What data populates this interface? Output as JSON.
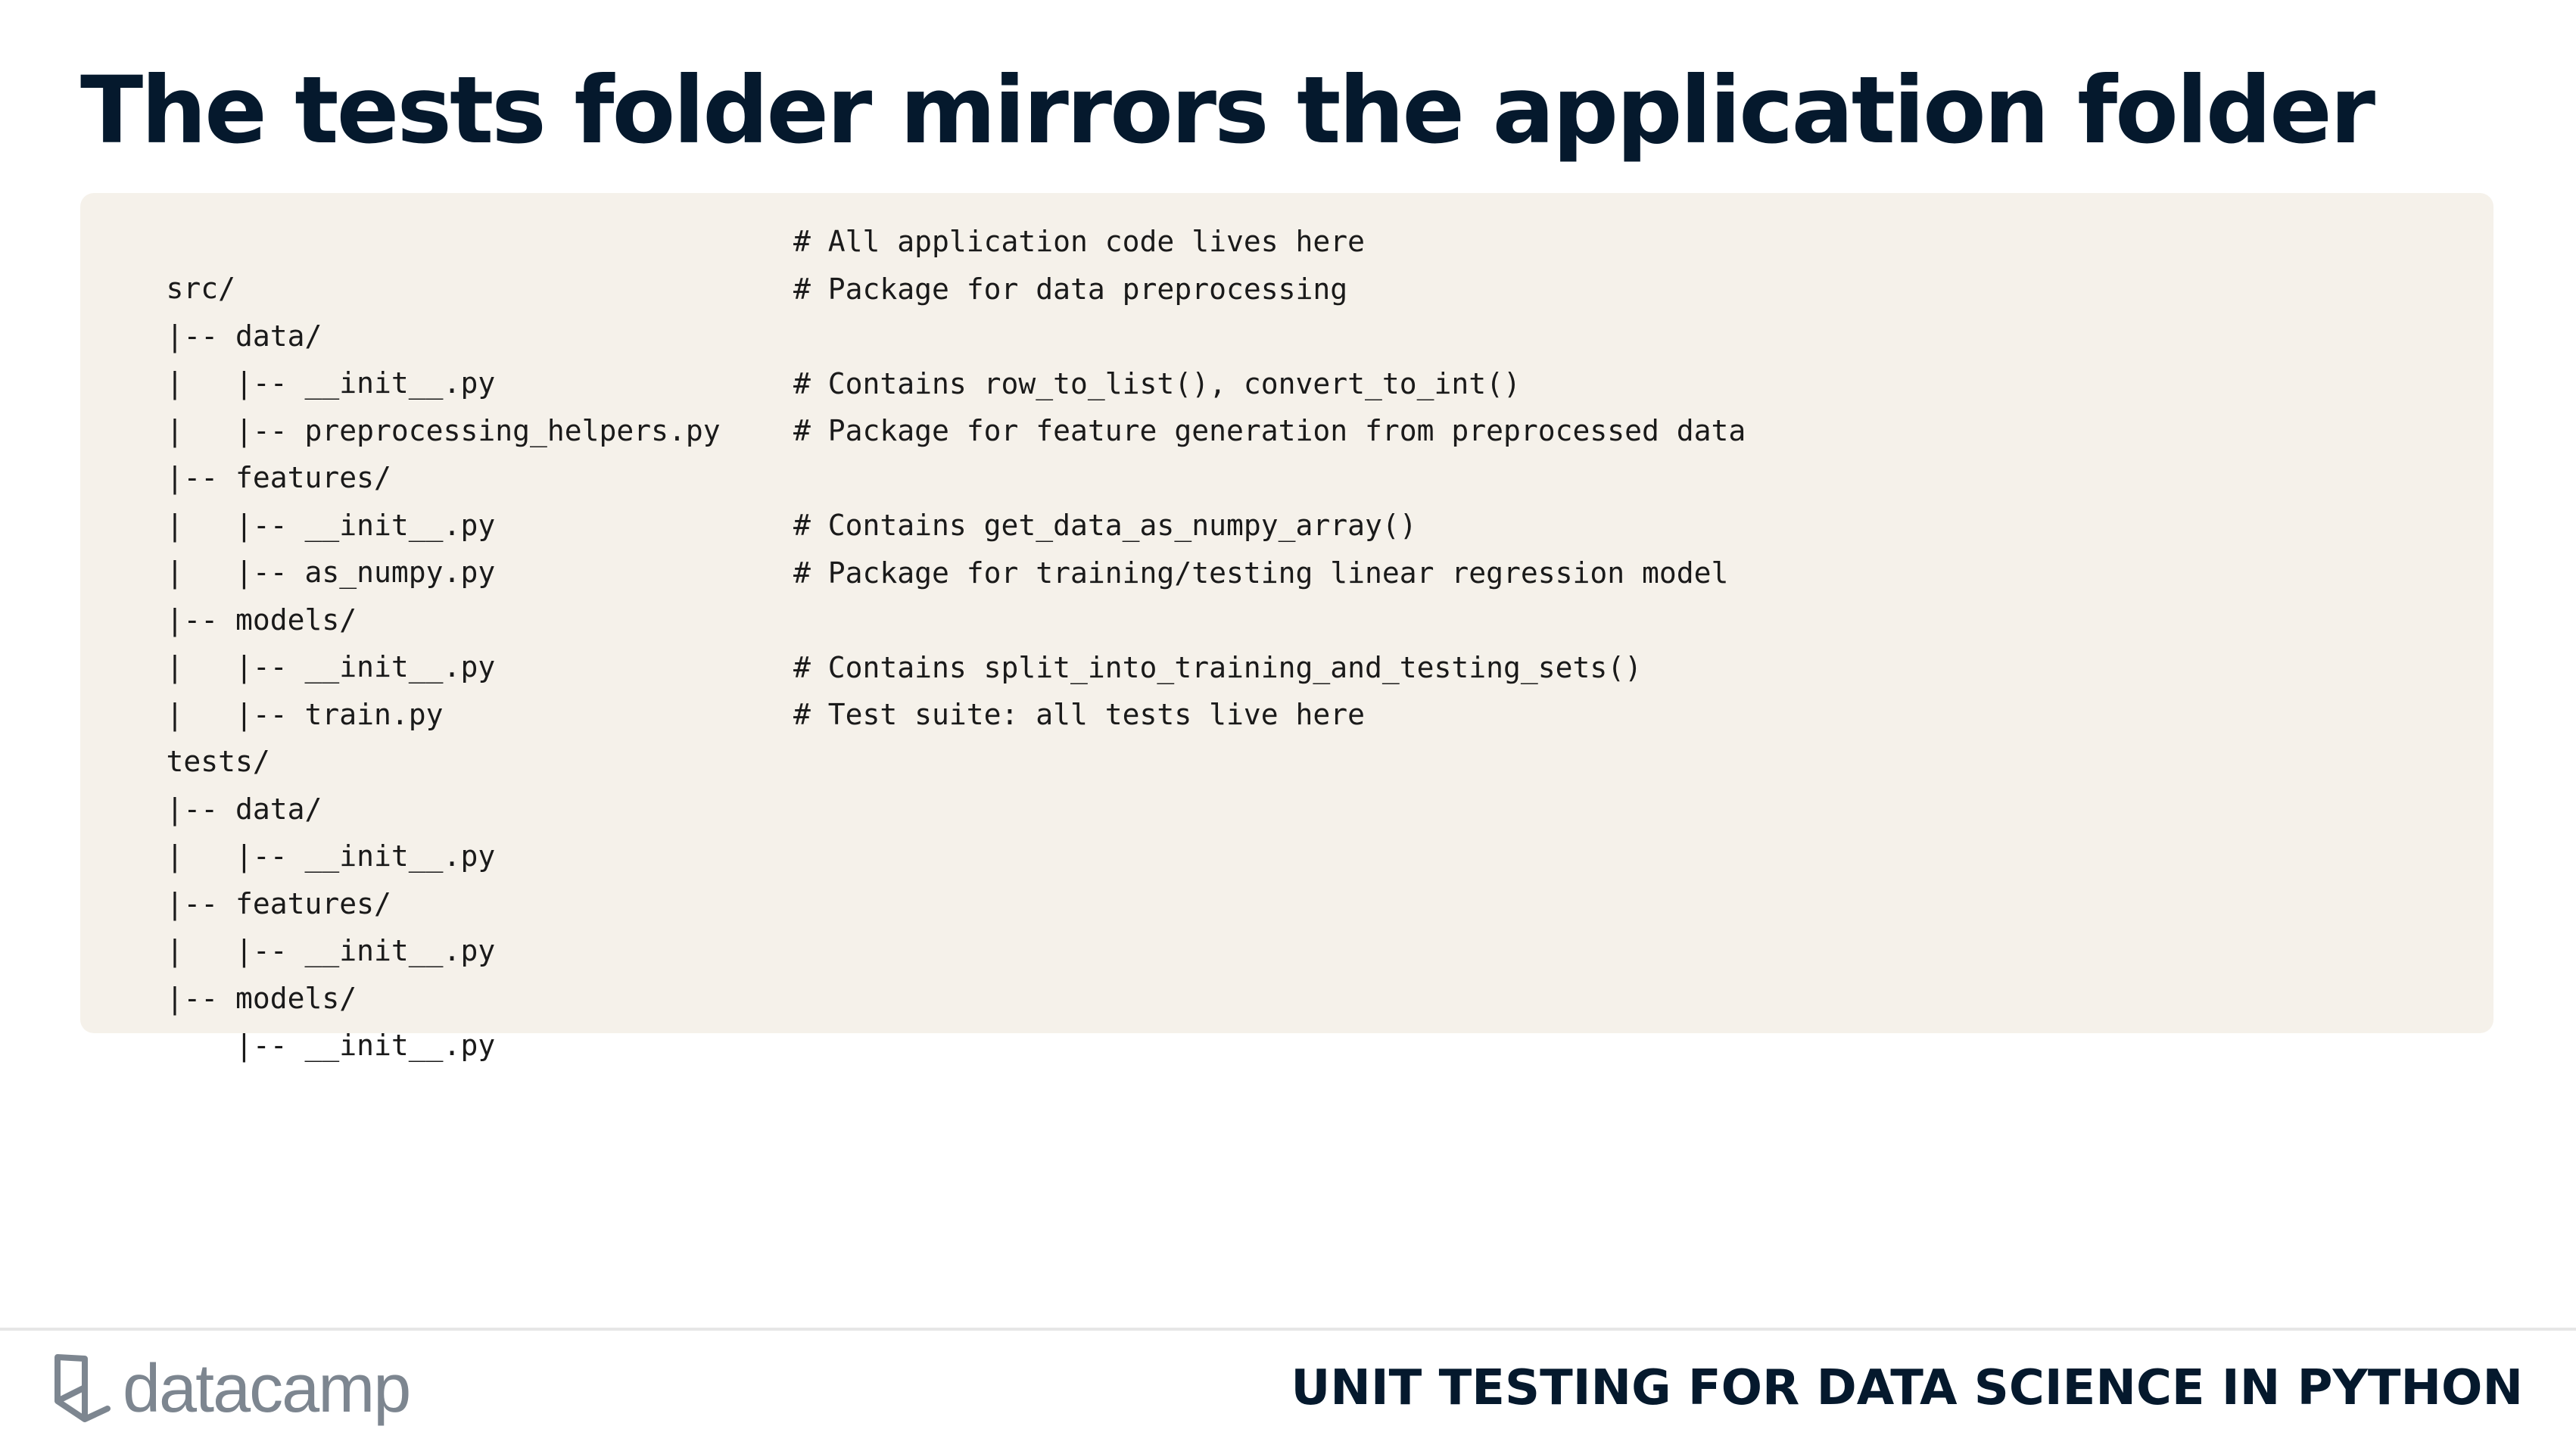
{
  "slide": {
    "title": "The tests folder mirrors the application folder"
  },
  "code": {
    "lines": [
      {
        "path": "src/",
        "comment": "# All application code lives here"
      },
      {
        "path": "|-- data/",
        "comment": "# Package for data preprocessing"
      },
      {
        "path": "|   |-- __init__.py",
        "comment": ""
      },
      {
        "path": "|   |-- preprocessing_helpers.py",
        "comment": "# Contains row_to_list(), convert_to_int()"
      },
      {
        "path": "|-- features/",
        "comment": "# Package for feature generation from preprocessed data"
      },
      {
        "path": "|   |-- __init__.py",
        "comment": ""
      },
      {
        "path": "|   |-- as_numpy.py",
        "comment": "# Contains get_data_as_numpy_array()"
      },
      {
        "path": "|-- models/",
        "comment": "# Package for training/testing linear regression model"
      },
      {
        "path": "|   |-- __init__.py",
        "comment": ""
      },
      {
        "path": "|   |-- train.py",
        "comment": "# Contains split_into_training_and_testing_sets()"
      },
      {
        "path": "tests/",
        "comment": "# Test suite: all tests live here"
      },
      {
        "path": "|-- data/",
        "comment": ""
      },
      {
        "path": "|   |-- __init__.py",
        "comment": ""
      },
      {
        "path": "|-- features/",
        "comment": ""
      },
      {
        "path": "|   |-- __init__.py",
        "comment": ""
      },
      {
        "path": "|-- models/",
        "comment": ""
      },
      {
        "path": "    |-- __init__.py",
        "comment": ""
      }
    ]
  },
  "footer": {
    "logo_text": "datacamp",
    "course_title": "UNIT TESTING FOR DATA SCIENCE IN PYTHON"
  },
  "colors": {
    "title": "#05192d",
    "code_background": "#f5f1ea",
    "logo_gray": "#7d8690"
  },
  "icons": {
    "logo_mark": "datacamp-logo-icon"
  }
}
